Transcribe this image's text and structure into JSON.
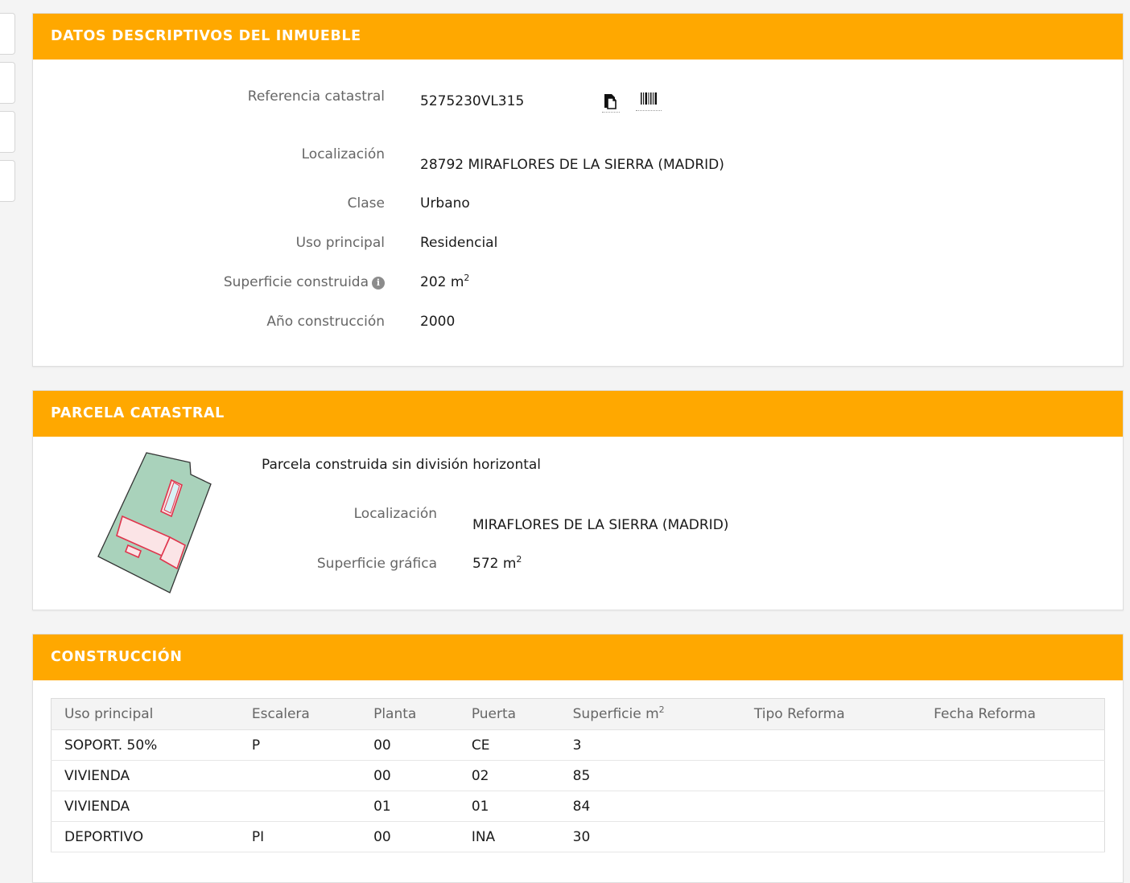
{
  "colors": {
    "header_bg": "#ffa800",
    "header_text": "#ffffff",
    "plot_fill": "#a9d2bb",
    "building_outline": "#e0344c"
  },
  "datos": {
    "title": "DATOS DESCRIPTIVOS DEL INMUEBLE",
    "referencia_label": "Referencia catastral",
    "referencia_value": "5275230VL315",
    "copy_icon": "copy-icon",
    "barcode_icon": "barcode-icon",
    "localizacion_label": "Localización",
    "localizacion_value": "28792 MIRAFLORES DE LA SIERRA (MADRID)",
    "clase_label": "Clase",
    "clase_value": "Urbano",
    "uso_label": "Uso principal",
    "uso_value": "Residencial",
    "superficie_label": "Superficie construida",
    "superficie_value": "202 m",
    "superficie_sup": "2",
    "info_icon_glyph": "i",
    "anio_label": "Año construcción",
    "anio_value": "2000"
  },
  "parcela": {
    "title": "PARCELA CATASTRAL",
    "subtitle": "Parcela construida sin división horizontal",
    "localizacion_label": "Localización",
    "localizacion_value": "MIRAFLORES DE LA SIERRA (MADRID)",
    "superficie_label": "Superficie gráfica",
    "superficie_value": "572 m",
    "superficie_sup": "2"
  },
  "construccion": {
    "title": "CONSTRUCCIÓN",
    "headers": {
      "uso": "Uso principal",
      "escalera": "Escalera",
      "planta": "Planta",
      "puerta": "Puerta",
      "superficie": "Superficie m",
      "superficie_sup": "2",
      "tipo": "Tipo Reforma",
      "fecha": "Fecha Reforma"
    },
    "rows": [
      {
        "uso": "SOPORT. 50%",
        "escalera": "P",
        "planta": "00",
        "puerta": "CE",
        "superficie": "3",
        "tipo": "",
        "fecha": ""
      },
      {
        "uso": "VIVIENDA",
        "escalera": "",
        "planta": "00",
        "puerta": "02",
        "superficie": "85",
        "tipo": "",
        "fecha": ""
      },
      {
        "uso": "VIVIENDA",
        "escalera": "",
        "planta": "01",
        "puerta": "01",
        "superficie": "84",
        "tipo": "",
        "fecha": ""
      },
      {
        "uso": "DEPORTIVO",
        "escalera": "PI",
        "planta": "00",
        "puerta": "INA",
        "superficie": "30",
        "tipo": "",
        "fecha": ""
      }
    ]
  }
}
